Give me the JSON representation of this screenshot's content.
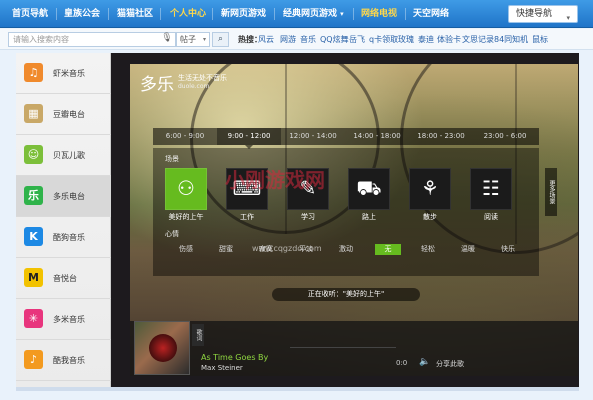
{
  "topnav": {
    "items": [
      "首页导航",
      "皇族公会",
      "猫猫社区",
      "个人中心",
      "新网页游戏",
      "经典网页游戏",
      "网络电视",
      "天空网络"
    ],
    "caret": "▾",
    "quick_nav": "快捷导航"
  },
  "search": {
    "placeholder": "请输入搜索内容",
    "scope": "帖子",
    "hot_label": "热搜：",
    "hot_links": [
      "风云",
      "网游",
      "音乐",
      "QQ炫舞",
      "岳飞",
      "q卡领取",
      "玫瑰",
      "泰迪",
      "体验卡",
      "文思记录",
      "84同知机",
      "鼠标"
    ]
  },
  "sidebar": {
    "items": [
      {
        "label": "虾米音乐",
        "icon": "xiami-icon",
        "glyph": "♫",
        "color": "#f08a2c"
      },
      {
        "label": "豆瓣电台",
        "icon": "douban-icon",
        "glyph": "▦",
        "color": "#c9a867"
      },
      {
        "label": "贝瓦儿歌",
        "icon": "beiwa-icon",
        "glyph": "☺",
        "color": "#7cbf3a"
      },
      {
        "label": "多乐电台",
        "icon": "duole-icon",
        "glyph": "乐",
        "color": "#2fb34a"
      },
      {
        "label": "酷狗音乐",
        "icon": "kugou-icon",
        "glyph": "K",
        "color": "#1d89e4"
      },
      {
        "label": "音悦台",
        "icon": "yinyuetai-icon",
        "glyph": "M",
        "color": "#f2c200"
      },
      {
        "label": "多米音乐",
        "icon": "duomi-icon",
        "glyph": "✳",
        "color": "#e8357d"
      },
      {
        "label": "酷我音乐",
        "icon": "kuwo-icon",
        "glyph": "♪",
        "color": "#f39a1f"
      }
    ]
  },
  "stage": {
    "logo": "多乐",
    "logo_sub": "生活无处不音乐",
    "logo_url": "duole.com",
    "times": [
      "6:00 - 9:00",
      "9:00 - 12:00",
      "12:00 - 14:00",
      "14:00 - 18:00",
      "18:00 - 23:00",
      "23:00 - 6:00"
    ],
    "scene_head": "场景",
    "scenes": [
      {
        "label": "美好的上午",
        "icon": "people-icon",
        "glyph": "⚇"
      },
      {
        "label": "工作",
        "icon": "work-icon",
        "glyph": "⌨"
      },
      {
        "label": "学习",
        "icon": "study-icon",
        "glyph": "✎"
      },
      {
        "label": "路上",
        "icon": "car-icon",
        "glyph": "⛟"
      },
      {
        "label": "散步",
        "icon": "walk-icon",
        "glyph": "⚘"
      },
      {
        "label": "阅读",
        "icon": "read-icon",
        "glyph": "☷"
      }
    ],
    "mood_head": "心情",
    "moods": [
      "伤感",
      "甜蜜",
      "寂寞",
      "平淡",
      "激动",
      "无",
      "轻松",
      "温暖",
      "快乐"
    ],
    "more": "更多场景",
    "now_playing": "正在收听：\"美好的上午\"",
    "watermark": "小刚游戏网",
    "watermark_url": "www.cqgzdo.com"
  },
  "player": {
    "lyrics": "歌词",
    "title": "As Time Goes By",
    "artist": "Max Steiner",
    "time": "0:0",
    "share": "分享此歌"
  }
}
